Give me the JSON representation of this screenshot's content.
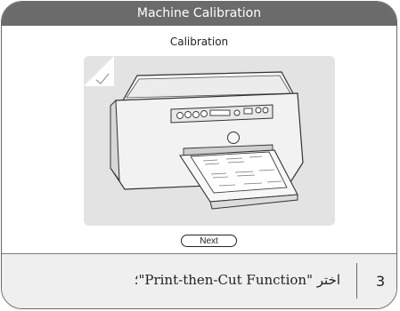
{
  "window": {
    "title": "Machine Calibration"
  },
  "screen": {
    "subtitle": "Calibration",
    "next_label": "Next"
  },
  "illustration": {
    "icon": "printer-with-calibration-sheet",
    "background": "#e3e3e3"
  },
  "footer": {
    "instruction": "اختر \"Print-then-Cut Function\"؛",
    "step_number": "3"
  },
  "colors": {
    "titlebar": "#6b6b6b",
    "footer_bg": "#efefef",
    "border": "#6a6a6a"
  }
}
